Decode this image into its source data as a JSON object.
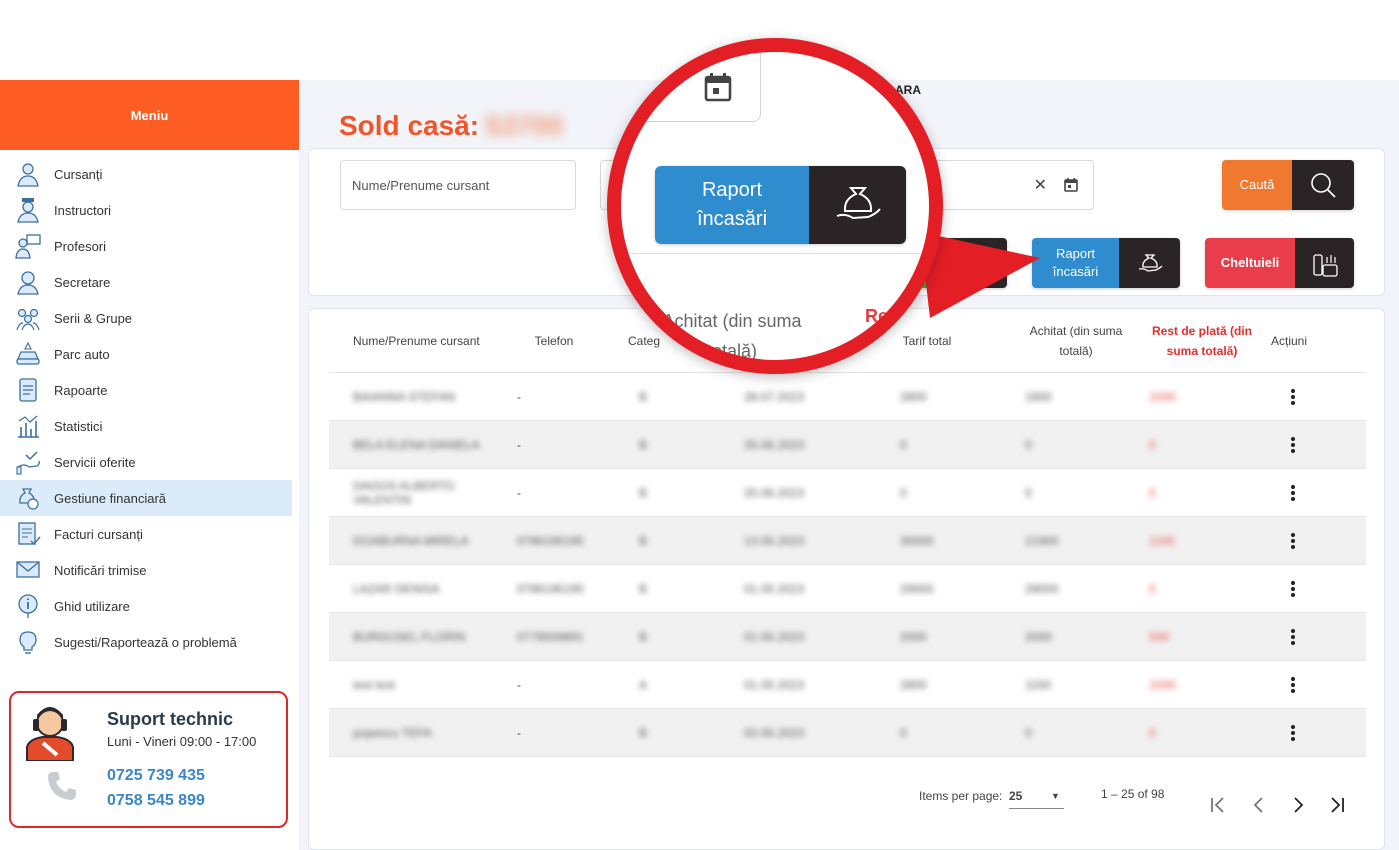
{
  "sidebar": {
    "menu_title": "Meniu",
    "items": [
      {
        "label": "Cursanți",
        "icon": "student-icon"
      },
      {
        "label": "Instructori",
        "icon": "instructor-icon"
      },
      {
        "label": "Profesori",
        "icon": "teacher-icon"
      },
      {
        "label": "Secretare",
        "icon": "secretary-icon"
      },
      {
        "label": "Serii & Grupe",
        "icon": "groups-icon"
      },
      {
        "label": "Parc auto",
        "icon": "car-icon"
      },
      {
        "label": "Rapoarte",
        "icon": "report-icon"
      },
      {
        "label": "Statistici",
        "icon": "statistics-icon"
      },
      {
        "label": "Servicii oferite",
        "icon": "services-icon"
      },
      {
        "label": "Gestiune financiară",
        "icon": "money-bag-icon"
      },
      {
        "label": "Facturi cursanți",
        "icon": "invoice-icon"
      },
      {
        "label": "Notificări trimise",
        "icon": "envelope-icon"
      },
      {
        "label": "Ghid utilizare",
        "icon": "info-icon"
      },
      {
        "label": "Sugesti/Raportează o problemă",
        "icon": "lightbulb-icon"
      }
    ],
    "active_index": 9,
    "support": {
      "title": "Suport technic",
      "hours": "Luni - Vineri 09:00 - 17:00",
      "phone1": "0725 739 435",
      "phone2": "0758 545 899"
    }
  },
  "header": {
    "sold_label": "Sold casă:",
    "sold_value": "53700"
  },
  "filters": {
    "search_placeholder": "Nume/Prenume cursant",
    "search_button": "Caută",
    "raport_button": "Raport încasări",
    "cheltuieli_button": "Cheltuieli",
    "top_fragment": "ARA"
  },
  "table": {
    "columns": [
      "Nume/Prenume cursant",
      "Telefon",
      "Categ",
      "",
      "Tarif total",
      "Achitat (din suma totală)",
      "Rest de plată (din suma totală)",
      "Acțiuni"
    ],
    "rows": [
      {
        "name": "BAIANNA STEFAN",
        "phone": "-",
        "cat": "B",
        "date": "28.07.2023",
        "tarif": "2800",
        "achitat": "1800",
        "rest": "1000"
      },
      {
        "name": "BELA ELENA DANIELA",
        "phone": "-",
        "cat": "B",
        "date": "25.06.2023",
        "tarif": "0",
        "achitat": "0",
        "rest": "0"
      },
      {
        "name": "DAGOS ALBERTO VALENTIN",
        "phone": "-",
        "cat": "B",
        "date": "25.06.2023",
        "tarif": "0",
        "achitat": "0",
        "rest": "0"
      },
      {
        "name": "DOABURNA MIRELA",
        "phone": "0786195195",
        "cat": "B",
        "date": "13.05.2023",
        "tarif": "30000",
        "achitat": "21900",
        "rest": "1100"
      },
      {
        "name": "LAZAR DENISA",
        "phone": "0786195195",
        "cat": "B",
        "date": "01.05.2023",
        "tarif": "29000",
        "achitat": "29000",
        "rest": "0"
      },
      {
        "name": "BURDUSEL FLORIN",
        "phone": "0778559891",
        "cat": "B",
        "date": "01.05.2023",
        "tarif": "2000",
        "achitat": "2000",
        "rest": "500"
      },
      {
        "name": "test test",
        "phone": "-",
        "cat": "A",
        "date": "01.05.2023",
        "tarif": "2800",
        "achitat": "1150",
        "rest": "1000"
      },
      {
        "name": "popescu TEFA",
        "phone": "-",
        "cat": "B",
        "date": "02.05.2023",
        "tarif": "0",
        "achitat": "0",
        "rest": "0"
      }
    ]
  },
  "pagination": {
    "items_per_page_label": "Items per page:",
    "items_per_page": "25",
    "range": "1 – 25 of 98"
  },
  "zoom": {
    "raport_button": "Raport încasări",
    "column_achitat": "Achitat (din suma totală)",
    "column_rest_fragment": "Res"
  },
  "colors": {
    "accent_orange": "#fd5d22",
    "button_blue": "#2e8ccf",
    "button_red": "#ea3d4b",
    "search_orange": "#f0782f",
    "callout_red": "#e31e24"
  }
}
